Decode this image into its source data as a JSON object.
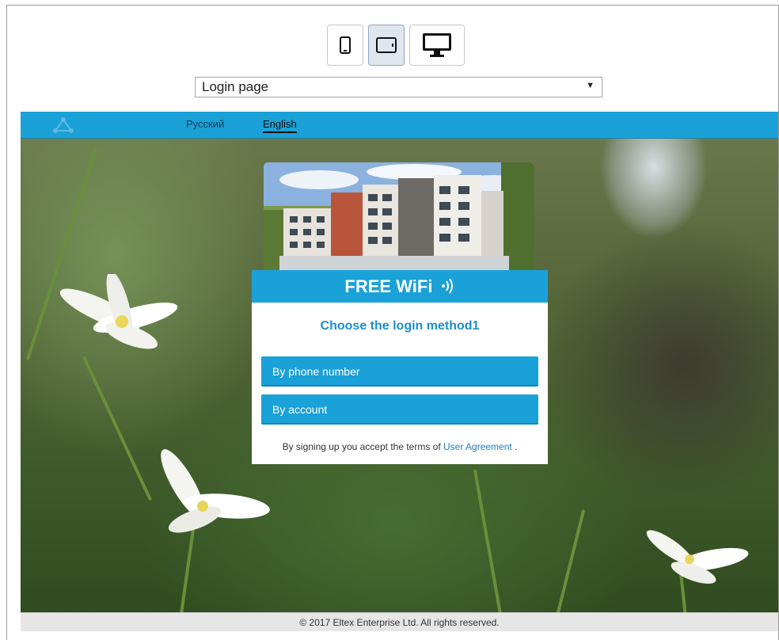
{
  "device_bar": {
    "buttons": [
      {
        "icon": "phone-icon"
      },
      {
        "icon": "tablet-icon",
        "active": true
      },
      {
        "icon": "desktop-icon"
      }
    ]
  },
  "page_select": {
    "selected": "Login page",
    "arrow": "▼"
  },
  "portal": {
    "languages": [
      "Русский",
      "English"
    ],
    "active_language": "English",
    "banner": "FREE WiFi",
    "title": "Choose the login method1",
    "buttons": {
      "phone": "By phone number",
      "account": "By account"
    },
    "terms_prefix": "By signing up you accept the terms of",
    "terms_link": "User Agreement",
    "terms_suffix": ".",
    "footer": "© 2017 Eltex Enterprise Ltd. All rights reserved."
  },
  "colors": {
    "accent": "#1aa1d8",
    "title": "#1e8fc9",
    "link": "#1e7fc0"
  }
}
